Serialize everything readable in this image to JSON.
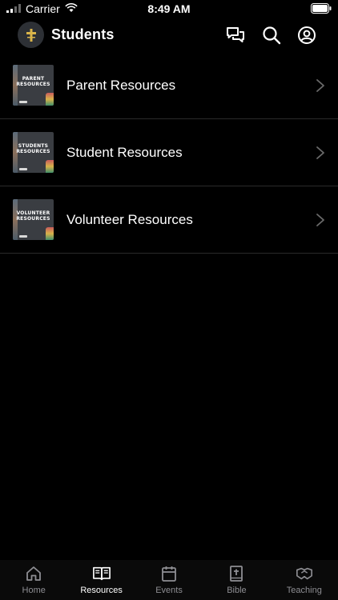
{
  "status_bar": {
    "carrier": "Carrier",
    "time": "8:49 AM"
  },
  "header": {
    "title": "Students",
    "icons": [
      "chat-icon",
      "search-icon",
      "profile-icon"
    ]
  },
  "resources": [
    {
      "label": "Parent Resources",
      "thumb_text": "PARENT\nRESOURCES"
    },
    {
      "label": "Student Resources",
      "thumb_text": "STUDENTS\nRESOURCES"
    },
    {
      "label": "Volunteer Resources",
      "thumb_text": "VOLUNTEER\nRESOURCES"
    }
  ],
  "tab_bar": {
    "tabs": [
      {
        "label": "Home",
        "icon": "home-icon",
        "active": false
      },
      {
        "label": "Resources",
        "icon": "book-icon",
        "active": true
      },
      {
        "label": "Events",
        "icon": "calendar-icon",
        "active": false
      },
      {
        "label": "Bible",
        "icon": "bible-icon",
        "active": false
      },
      {
        "label": "Teaching",
        "icon": "teaching-icon",
        "active": false
      }
    ]
  },
  "colors": {
    "background": "#000000",
    "text": "#ffffff",
    "inactive_tab": "#8e8e93",
    "divider": "#2a2a2a"
  }
}
